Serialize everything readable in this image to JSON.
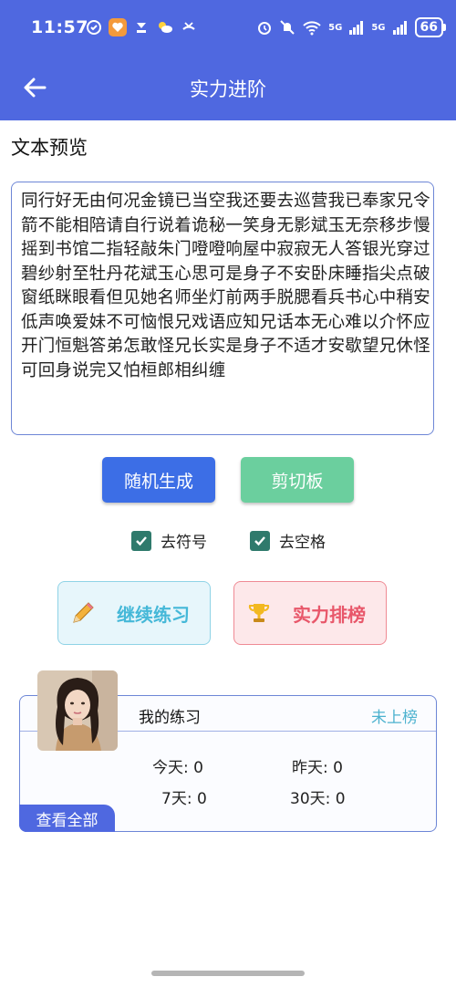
{
  "status_bar": {
    "time": "11:57",
    "network_5g": "5G",
    "battery": "66"
  },
  "app_bar": {
    "title": "实力进阶"
  },
  "preview": {
    "section_title": "文本预览",
    "text": "同行好无由何况金镜已当空我还要去巡营我已奉家兄令箭不能相陪请自行说着诡秘一笑身无影斌玉无奈移步慢摇到书馆二指轻敲朱门噔噔响屋中寂寂无人答银光穿过碧纱射至牡丹花斌玉心思可是身子不安卧床睡指尖点破窗纸眯眼看但见她名师坐灯前两手脱腮看兵书心中稍安低声唤爱妹不可恼恨兄戏语应知兄话本无心难以介怀应开门恒魁答弟怎敢怪兄长实是身子不适才安歇望兄休怪可回身说完又怕桓郎相纠缠"
  },
  "buttons": {
    "random": "随机生成",
    "clipboard": "剪切板"
  },
  "options": {
    "remove_symbols": {
      "label": "去符号",
      "checked": true
    },
    "remove_spaces": {
      "label": "去空格",
      "checked": true
    }
  },
  "actions": {
    "continue": "继续练习",
    "ranking": "实力排榜"
  },
  "practice": {
    "title": "我的练习",
    "rank_status": "未上榜",
    "today": "今天: 0",
    "yesterday": "昨天: 0",
    "seven_days": "7天: 0",
    "thirty_days": "30天: 0",
    "view_all": "查看全部"
  },
  "colors": {
    "primary": "#4f68e0",
    "clipboard_green": "#6bcf9e",
    "checkbox_teal": "#2f7a6c",
    "continue_text": "#45b8d8",
    "ranking_text": "#e8576a"
  },
  "icons": {
    "back": "arrow-left-icon",
    "pencil": "pencil-icon",
    "trophy": "trophy-icon",
    "check": "checkmark-icon"
  }
}
